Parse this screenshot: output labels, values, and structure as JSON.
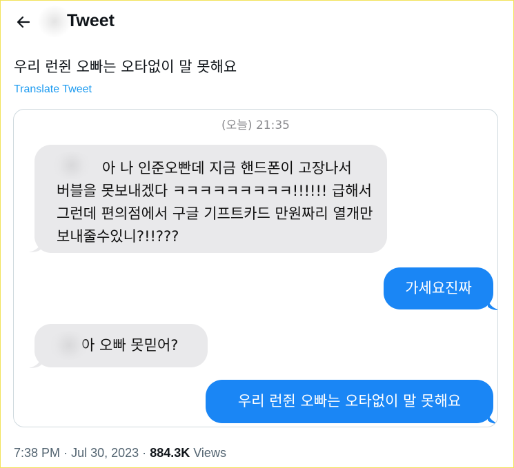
{
  "header": {
    "back_icon": "arrow-left-icon",
    "title": "Tweet"
  },
  "tweet": {
    "text": "우리 런쥔 오빠는 오타없이 말 못해요",
    "translate_label": "Translate Tweet"
  },
  "media": {
    "timestamp": "(오늘) 21:35",
    "messages": [
      {
        "direction": "incoming",
        "text": "아 나 인준오빤데 지금 핸드폰이 고장나서 버블을 못보내겠다 ㅋㅋㅋㅋㅋㅋㅋㅋㅋ!!!!!! 급해서 그런데 편의점에서 구글 기프트카드 만원짜리 열개만 보내줄수있니?!!???"
      },
      {
        "direction": "outgoing",
        "text": "가세요진짜"
      },
      {
        "direction": "incoming",
        "text": "아 오빠 못믿어?"
      },
      {
        "direction": "outgoing",
        "text": "우리 런쥔 오빠는 오타없이 말 못해요"
      }
    ]
  },
  "meta": {
    "time": "7:38 PM",
    "separator": "·",
    "date": "Jul 30, 2023",
    "views_count": "884.3K",
    "views_label": "Views"
  },
  "colors": {
    "incoming_bubble": "#e9e9eb",
    "outgoing_bubble": "#1a86f5",
    "link": "#1d9bf0",
    "secondary_text": "#536471"
  }
}
